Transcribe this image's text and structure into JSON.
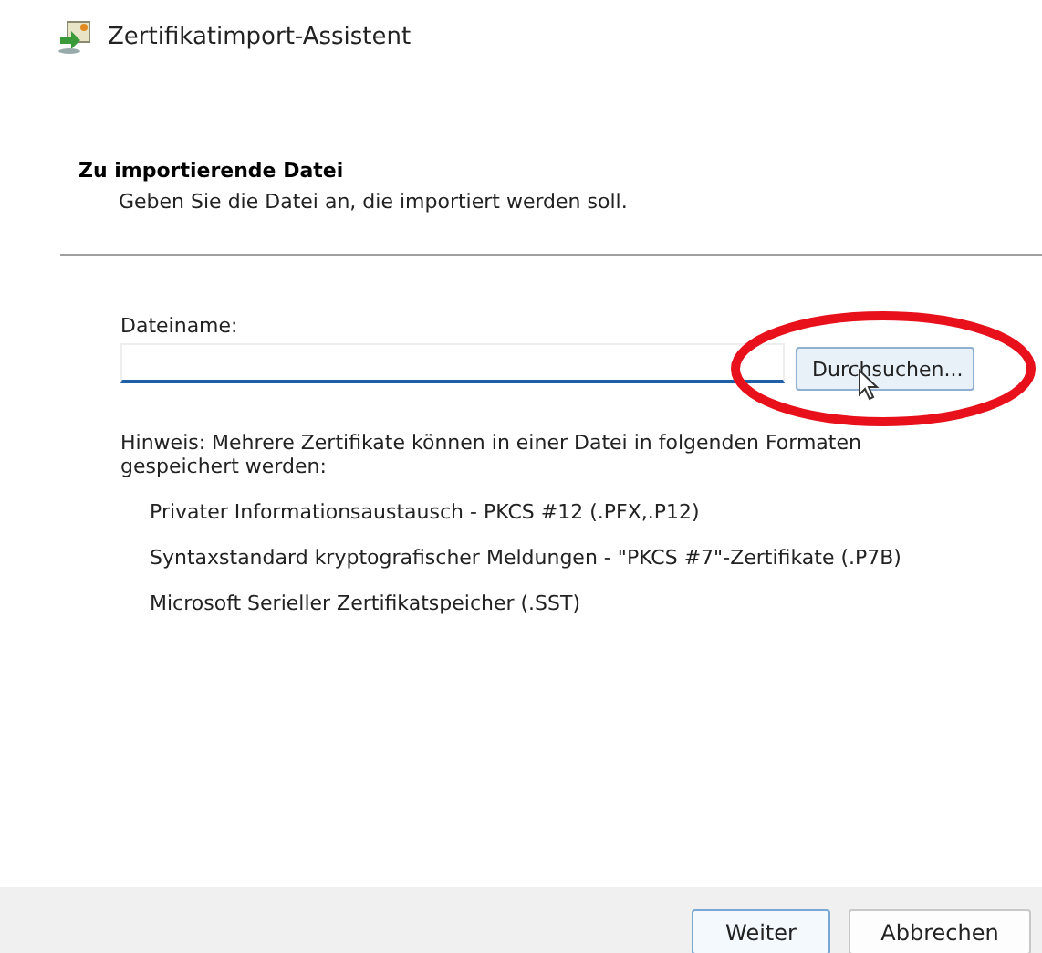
{
  "window": {
    "title": "Zertifikatimport-Assistent"
  },
  "header": {
    "heading": "Zu importierende Datei",
    "subtitle": "Geben Sie die Datei an, die importiert werden soll."
  },
  "file_field": {
    "label": "Dateiname:",
    "browse_button": "Durchsuchen...",
    "focused": true
  },
  "note": "Hinweis: Mehrere Zertifikate können in einer Datei in folgenden Formaten gespeichert werden:",
  "formats": [
    "Privater Informationsaustausch - PKCS #12 (.PFX,.P12)",
    "Syntaxstandard kryptografischer Meldungen - \"PKCS #7\"-Zertifikate (.P7B)",
    "Microsoft Serieller Zertifikatspeicher (.SST)"
  ],
  "buttons": [
    {
      "label": "Weiter",
      "default": true
    },
    {
      "label": "Abbrechen",
      "default": false
    }
  ]
}
